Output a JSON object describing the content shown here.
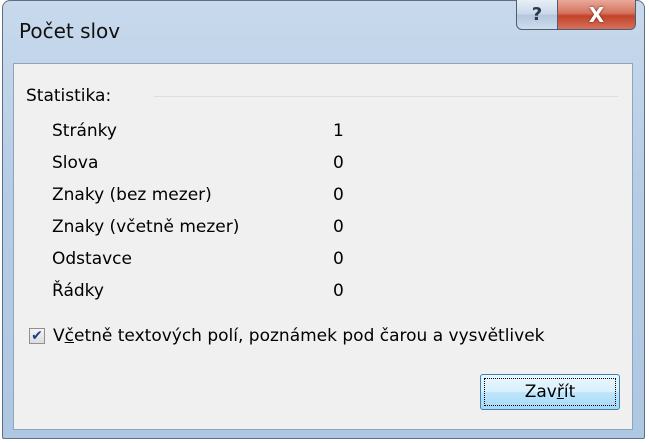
{
  "window": {
    "title": "Počet slov",
    "help_glyph": "?",
    "close_glyph": "X"
  },
  "statistics": {
    "group_label": "Statistika:",
    "rows": [
      {
        "label": "Stránky",
        "value": "1"
      },
      {
        "label": "Slova",
        "value": "0"
      },
      {
        "label": "Znaky (bez mezer)",
        "value": "0"
      },
      {
        "label": "Znaky (včetně mezer)",
        "value": "0"
      },
      {
        "label": "Odstavce",
        "value": "0"
      },
      {
        "label": "Řádky",
        "value": "0"
      }
    ]
  },
  "options": {
    "include_checkbox": {
      "checked": true,
      "label_prefix": "V",
      "label_accel": "č",
      "label_rest": "etně textových polí, poznámek pod čarou a vysvětlivek"
    }
  },
  "buttons": {
    "close": {
      "label_prefix": "Zav",
      "label_accel": "ř",
      "label_rest": "ít"
    }
  },
  "colors": {
    "frame": "#b7cde6",
    "client_bg": "#f0f0f0",
    "close_caption": "#c2432a",
    "button_border": "#3c7fb1"
  }
}
